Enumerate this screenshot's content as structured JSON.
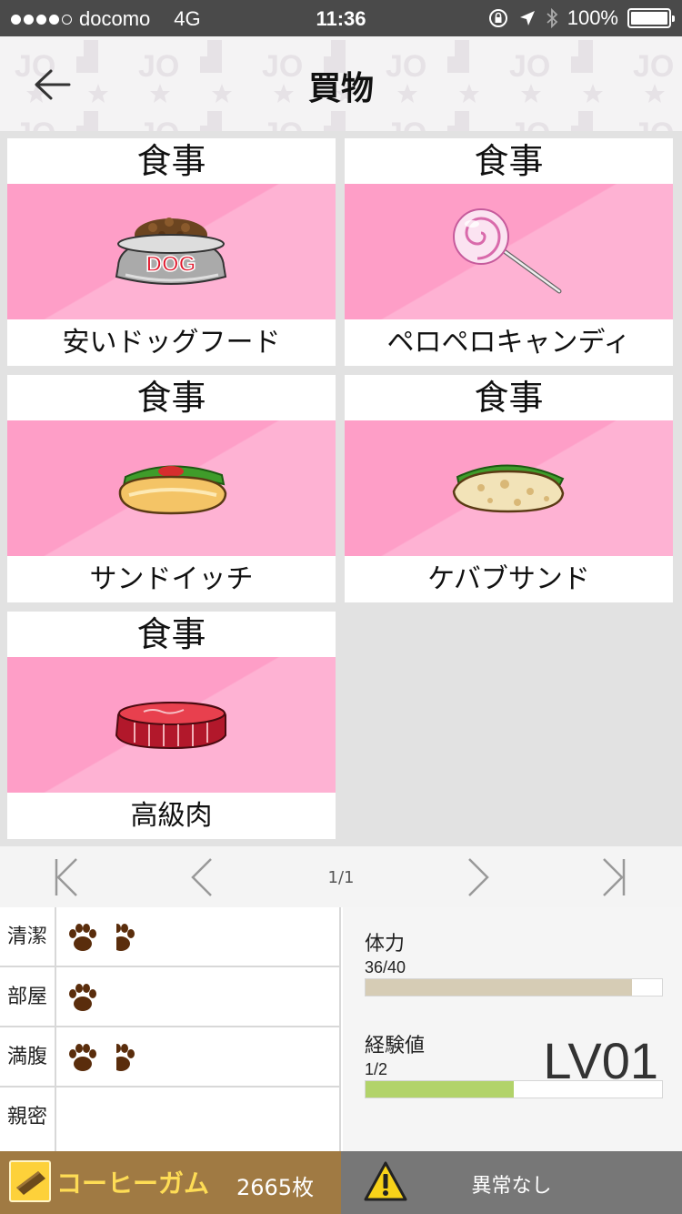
{
  "status_bar": {
    "carrier": "docomo",
    "network": "4G",
    "time": "11:36",
    "battery": "100%",
    "signal_bars": 4
  },
  "header": {
    "title": "買物",
    "back_icon": "arrow-left-icon"
  },
  "items": [
    {
      "category": "食事",
      "name": "安いドッグフード",
      "icon": "dog-food-bowl-icon",
      "bowl_label": "DOG"
    },
    {
      "category": "食事",
      "name": "ペロペロキャンディ",
      "icon": "lollipop-icon"
    },
    {
      "category": "食事",
      "name": "サンドイッチ",
      "icon": "sandwich-icon"
    },
    {
      "category": "食事",
      "name": "ケバブサンド",
      "icon": "kebab-icon"
    },
    {
      "category": "食事",
      "name": "高級肉",
      "icon": "meat-icon"
    }
  ],
  "pager": {
    "page": "1/1"
  },
  "needs": [
    {
      "label": "清潔",
      "paws": 1.5
    },
    {
      "label": "部屋",
      "paws": 1
    },
    {
      "label": "満腹",
      "paws": 1.5
    },
    {
      "label": "親密",
      "paws": 0
    }
  ],
  "stats": {
    "stamina_label": "体力",
    "stamina_value": "36/40",
    "stamina_fraction": 0.9,
    "stamina_color": "#d6ccb5",
    "exp_label": "経験値",
    "exp_value": "1/2",
    "exp_fraction": 0.5,
    "exp_color": "#b2d36a",
    "level": "LV01"
  },
  "currency": {
    "name": "コーヒーガム",
    "amount": "2665枚",
    "icon": "coffee-gum-icon"
  },
  "condition": {
    "text": "異常なし",
    "icon": "warning-icon"
  }
}
